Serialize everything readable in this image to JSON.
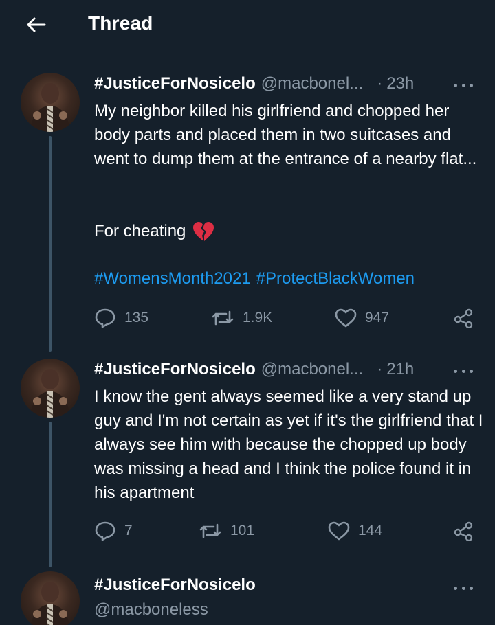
{
  "header": {
    "title": "Thread",
    "back_icon": "arrow-left-icon"
  },
  "colors": {
    "background": "#15202b",
    "hashtag": "#1d9bf0",
    "muted": "#8b98a5",
    "heart_emoji": "#e0245e"
  },
  "tweets": [
    {
      "name": "#JusticeForNosicelo",
      "handle": "@macbonel...",
      "separator": "·",
      "time": "23h",
      "text": "My neighbor killed his girlfriend and chopped her body parts and placed them in two suitcases and went to dump them at the entrance of a nearby flat...",
      "text2": "For cheating",
      "emoji": "broken-heart-icon",
      "hashtags": [
        "#WomensMonth2021",
        "#ProtectBlackWomen"
      ],
      "replies": "135",
      "retweets": "1.9K",
      "likes": "947"
    },
    {
      "name": "#JusticeForNosicelo",
      "handle": "@macbonel...",
      "separator": "·",
      "time": "21h",
      "text": "I know the gent always seemed like a very stand up guy and I'm not certain as yet if it's the girlfriend that I always see him with because the chopped up body was missing a head and I think the police found it in his apartment",
      "replies": "7",
      "retweets": "101",
      "likes": "144"
    },
    {
      "name": "#JusticeForNosicelo",
      "handle": "@macboneless"
    }
  ]
}
